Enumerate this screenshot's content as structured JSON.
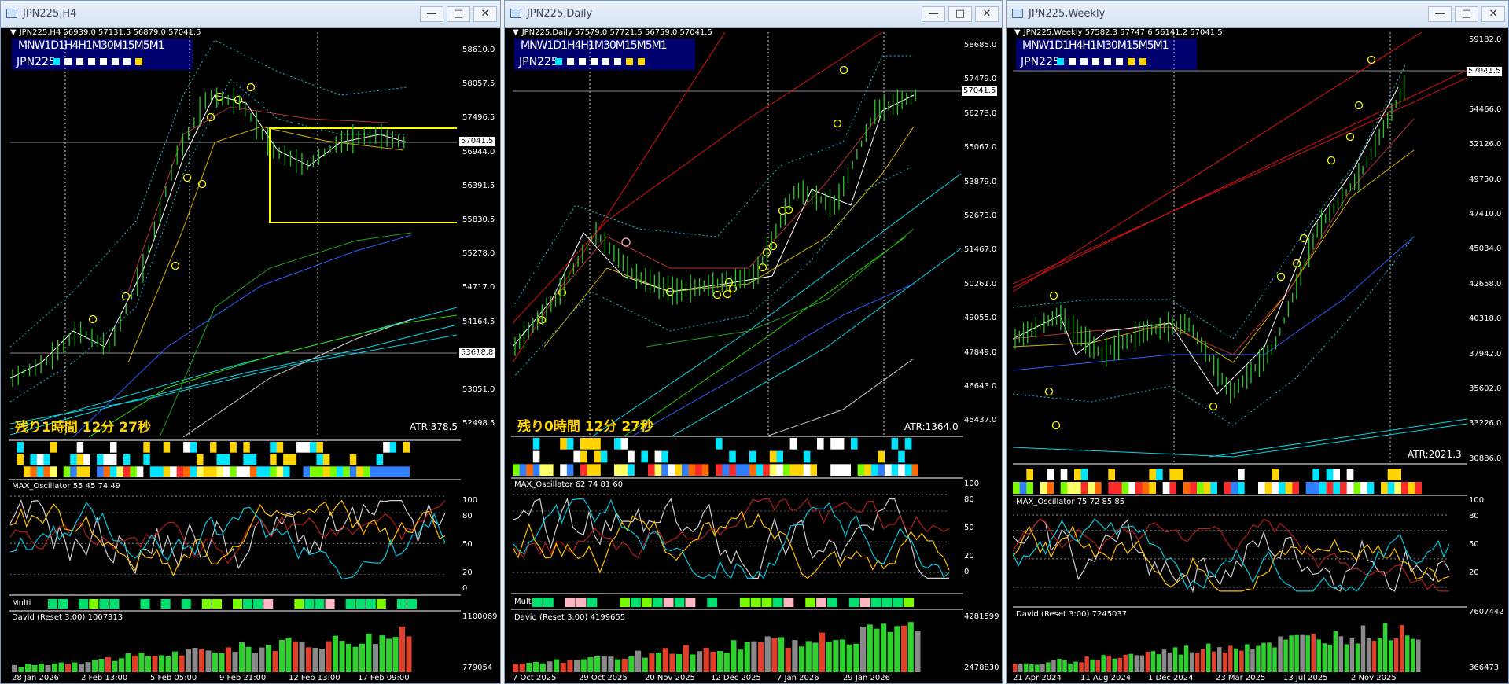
{
  "windows": [
    {
      "title": "JPN225,H4",
      "info": "JPN225,H4  56939.0 57131.5 56879.0 57041.5",
      "tf_panel": {
        "labels": "MNW1D1H4H1M30M15M5M1",
        "symbol": "JPN225",
        "squares": [
          "#00e5ff",
          "#ffffff",
          "#ffffff",
          "#ffffff",
          "#ffffff",
          "#ffffff",
          "#ffffff",
          "#ffd400"
        ]
      },
      "price_axis": [
        "58610.0",
        "58057.5",
        "57496.5",
        "56944.0",
        "56391.5",
        "55830.5",
        "55278.0",
        "54717.0",
        "54164.5",
        "53601.0",
        "53051.0",
        "52498.5"
      ],
      "price_current": "57041.5",
      "price_extra": "53618.8",
      "time_left": "残り1時間 12分 27秒",
      "atr": "ATR:378.5",
      "rows": [
        "W1",
        "D1",
        ""
      ],
      "oscillator": {
        "label": "MAX_Oscillator 55 45 74 49",
        "levels": [
          "100",
          "80",
          "50",
          "20",
          "0"
        ]
      },
      "multi": {
        "label": "Multi"
      },
      "david": {
        "label": "David (Reset 3:00) 1007313",
        "max": "1100069",
        "min": "779054"
      },
      "dates": [
        "28 Jan 2026",
        "2 Feb 13:00",
        "5 Feb 05:00",
        "9 Feb 21:00",
        "12 Feb 13:00",
        "17 Feb 09:00"
      ]
    },
    {
      "title": "JPN225,Daily",
      "info": "JPN225,Daily  57579.0 57721.5 56759.0 57041.5",
      "tf_panel": {
        "labels": "MNW1D1H4H1M30M15M5M1",
        "symbol": "JPN225",
        "squares": [
          "#00e5ff",
          "#ffffff",
          "#ffffff",
          "#ffffff",
          "#ffffff",
          "#ffffff",
          "#ffd400",
          "#ffd400"
        ]
      },
      "price_axis": [
        "58685.0",
        "57479.0",
        "56273.0",
        "55067.0",
        "53879.0",
        "52673.0",
        "51467.0",
        "50261.0",
        "49055.0",
        "47849.0",
        "46643.0",
        "45437.0"
      ],
      "price_current": "57041.5",
      "time_left": "残り0時間 12分 27秒",
      "atr": "ATR:1364.0",
      "rows": [
        "",
        "W1",
        ""
      ],
      "oscillator": {
        "label": "MAX_Oscillator 62 74 81 60",
        "levels": [
          "100",
          "80",
          "50",
          "20",
          "0"
        ]
      },
      "multi": {
        "label": "Multi"
      },
      "david": {
        "label": "David (Reset 3:00) 4199655",
        "max": "4281599",
        "min": "2478830"
      },
      "dates": [
        "7 Oct 2025",
        "29 Oct 2025",
        "20 Nov 2025",
        "12 Dec 2025",
        "7 Jan 2026",
        "29 Jan 2026"
      ]
    },
    {
      "title": "JPN225,Weekly",
      "info": "JPN225,Weekly  57582.3 57747.6 56141.2 57041.5",
      "tf_panel": {
        "labels": "MNW1D1H4H1M30M15M5M1",
        "symbol": "JPN225",
        "squares": [
          "#00e5ff",
          "#ffffff",
          "#ffffff",
          "#ffffff",
          "#ffffff",
          "#ffffff",
          "#ffd400",
          "#ffd400"
        ]
      },
      "price_axis": [
        "59182.0",
        "56807.0",
        "54466.0",
        "52126.0",
        "49750.0",
        "47410.0",
        "45034.0",
        "42658.0",
        "40318.0",
        "37942.0",
        "35602.0",
        "33226.0",
        "30886.0"
      ],
      "price_current": "57041.5",
      "atr": "ATR:2021.3",
      "rows": [
        "N",
        ""
      ],
      "oscillator": {
        "label": "MAX_Oscillator 75 72 85 85",
        "levels": [
          "100",
          "80",
          "50",
          "20"
        ]
      },
      "david": {
        "label": "David (Reset 3:00) 7245037",
        "max": "7607442",
        "min": "366473"
      },
      "dates": [
        "21 Apr 2024",
        "11 Aug 2024",
        "1 Dec 2024",
        "23 Mar 2025",
        "13 Jul 2025",
        "2 Nov 2025"
      ]
    }
  ]
}
